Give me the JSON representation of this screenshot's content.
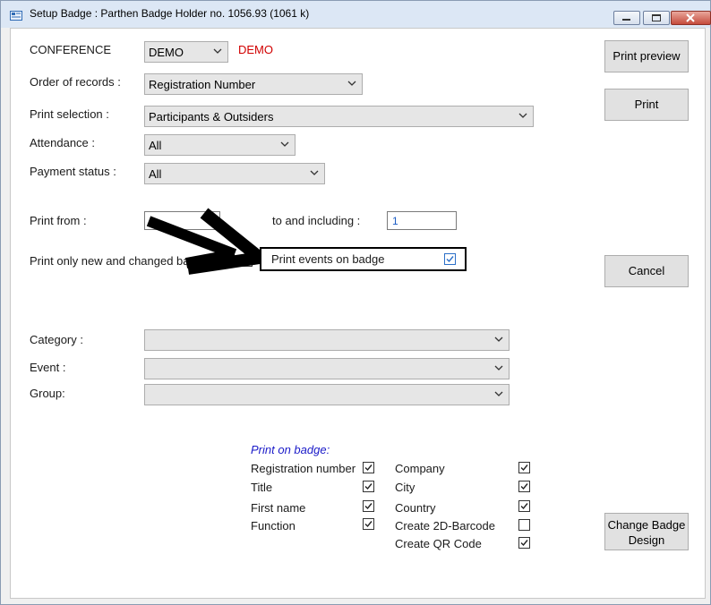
{
  "window": {
    "title": "Setup Badge : Parthen Badge Holder no. 1056.93 (1061 k)",
    "icon": "window-app-icon"
  },
  "form": {
    "conference_label": "CONFERENCE",
    "conference_value": "DEMO",
    "conference_name": "DEMO",
    "order_label": "Order of records :",
    "order_value": "Registration Number",
    "selection_label": "Print selection :",
    "selection_value": "Participants & Outsiders",
    "attendance_label": "Attendance :",
    "attendance_value": "All",
    "payment_label": "Payment status :",
    "payment_value": "All",
    "print_from_label": "Print from :",
    "print_from_value": "",
    "to_label": "to and including :",
    "to_value": "1",
    "only_new_label": "Print only new and changed badges",
    "print_events_label": "Print events on badge",
    "print_events_checked": true,
    "category_label": "Category :",
    "event_label": "Event :",
    "group_label": "Group:"
  },
  "buttons": {
    "print_preview": "Print preview",
    "print": "Print",
    "cancel": "Cancel",
    "change_design_line1": "Change Badge",
    "change_design_line2": "Design"
  },
  "print_on_badge": {
    "title": "Print on badge:",
    "left": [
      {
        "label": "Registration number",
        "checked": true
      },
      {
        "label": "Title",
        "checked": true
      },
      {
        "label": "First name",
        "checked": true
      },
      {
        "label": "Function",
        "checked": true
      }
    ],
    "right": [
      {
        "label": "Company",
        "checked": true
      },
      {
        "label": "City",
        "checked": true
      },
      {
        "label": "Country",
        "checked": true
      },
      {
        "label": "Create 2D-Barcode",
        "checked": false
      },
      {
        "label": "Create QR Code",
        "checked": true
      }
    ]
  },
  "colors": {
    "accent_red": "#d10000",
    "section_blue": "#1a1ac8",
    "link_blue": "#1a5bc4"
  }
}
